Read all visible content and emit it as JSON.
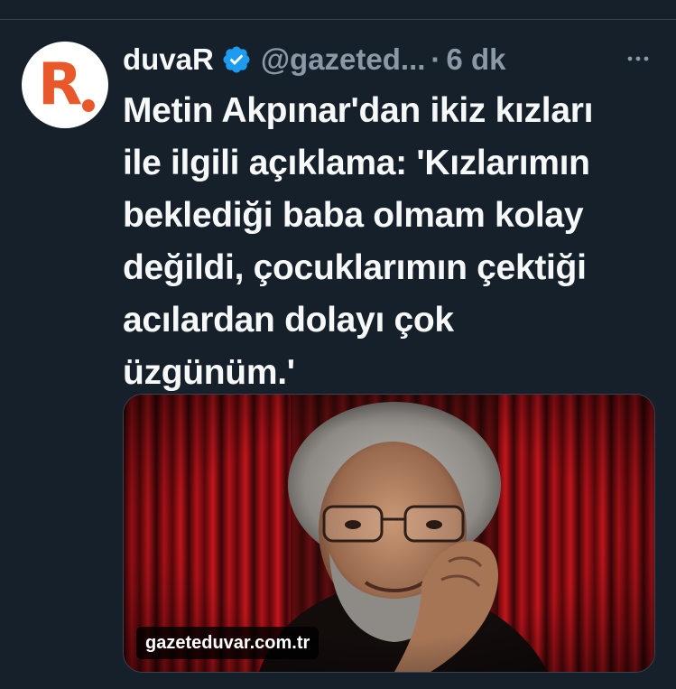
{
  "tweet": {
    "author_name": "duvaR",
    "handle": "@gazeted...",
    "separator": "·",
    "time": "6 dk",
    "text_lines": [
      "Metin Akpınar'dan ikiz kızları",
      "ile ilgili açıklama: 'Kızlarımın",
      "beklediği baba olmam kolay",
      "değildi, çocuklarımın çektiği",
      "acılardan dolayı çok",
      "üzgünüm.'"
    ],
    "media": {
      "link_label": "gazeteduvar.com.tr"
    },
    "avatar": {
      "logo_letter": "R"
    }
  },
  "icons": {
    "verified": "verified-badge-icon",
    "more": "more-horizontal-icon"
  },
  "colors": {
    "background": "#15202b",
    "text_primary": "#f7f9f9",
    "text_secondary": "#8b98a5",
    "verified": "#1d9bf0",
    "brand_orange": "#e8582a",
    "divider": "#38444d"
  }
}
